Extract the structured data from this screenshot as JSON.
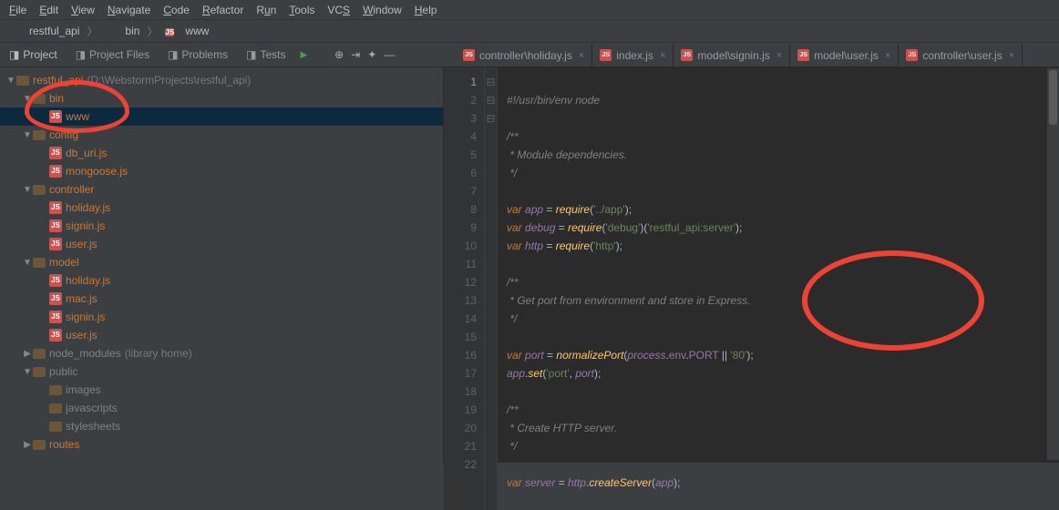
{
  "menu": [
    "File",
    "Edit",
    "View",
    "Navigate",
    "Code",
    "Refactor",
    "Run",
    "Tools",
    "VCS",
    "Window",
    "Help"
  ],
  "breadcrumb": [
    {
      "icon": "folder",
      "label": "restful_api"
    },
    {
      "icon": "folder",
      "label": "bin"
    },
    {
      "icon": "js",
      "label": "www"
    }
  ],
  "toolTabs": [
    {
      "icon": "project",
      "label": "Project",
      "selected": true
    },
    {
      "icon": "files",
      "label": "Project Files"
    },
    {
      "icon": "problem",
      "label": "Problems"
    },
    {
      "icon": "test",
      "label": "Tests"
    }
  ],
  "tree": [
    {
      "d": 0,
      "tw": "▼",
      "ico": "prj",
      "lbl": "restful_api",
      "hint": "(D:\\WebstormProjects\\restful_api)"
    },
    {
      "d": 1,
      "tw": "▼",
      "ico": "folder",
      "lbl": "bin"
    },
    {
      "d": 2,
      "tw": "",
      "ico": "js",
      "lbl": "www",
      "sel": true
    },
    {
      "d": 1,
      "tw": "▼",
      "ico": "folder",
      "lbl": "config"
    },
    {
      "d": 2,
      "tw": "",
      "ico": "js",
      "lbl": "db_uri.js"
    },
    {
      "d": 2,
      "tw": "",
      "ico": "js",
      "lbl": "mongoose.js"
    },
    {
      "d": 1,
      "tw": "▼",
      "ico": "folder",
      "lbl": "controller"
    },
    {
      "d": 2,
      "tw": "",
      "ico": "js",
      "lbl": "holiday.js"
    },
    {
      "d": 2,
      "tw": "",
      "ico": "js",
      "lbl": "signin.js"
    },
    {
      "d": 2,
      "tw": "",
      "ico": "js",
      "lbl": "user.js"
    },
    {
      "d": 1,
      "tw": "▼",
      "ico": "folder",
      "lbl": "model"
    },
    {
      "d": 2,
      "tw": "",
      "ico": "js",
      "lbl": "holiday.js"
    },
    {
      "d": 2,
      "tw": "",
      "ico": "js",
      "lbl": "mac.js"
    },
    {
      "d": 2,
      "tw": "",
      "ico": "js",
      "lbl": "signin.js"
    },
    {
      "d": 2,
      "tw": "",
      "ico": "js",
      "lbl": "user.js"
    },
    {
      "d": 1,
      "tw": "▶",
      "ico": "folder",
      "lbl": "node_modules",
      "hint": "(library home)",
      "dim": true
    },
    {
      "d": 1,
      "tw": "▼",
      "ico": "folder",
      "lbl": "public",
      "dim": true
    },
    {
      "d": 2,
      "tw": "",
      "ico": "folder",
      "lbl": "images",
      "dim": true
    },
    {
      "d": 2,
      "tw": "",
      "ico": "folder",
      "lbl": "javascripts",
      "dim": true
    },
    {
      "d": 2,
      "tw": "",
      "ico": "folder",
      "lbl": "stylesheets",
      "dim": true
    },
    {
      "d": 1,
      "tw": "▶",
      "ico": "folder",
      "lbl": "routes"
    }
  ],
  "editorTabs": [
    {
      "label": "controller\\holiday.js"
    },
    {
      "label": "index.js"
    },
    {
      "label": "model\\signin.js"
    },
    {
      "label": "model\\user.js"
    },
    {
      "label": "controller\\user.js"
    }
  ],
  "code": {
    "l1": "#!/usr/bin/env node",
    "l4": " * Module dependencies.",
    "l7a": "var",
    "l7b": "app",
    "l7c": "require",
    "l7d": "'../app'",
    "l8a": "var",
    "l8b": "debug",
    "l8c": "require",
    "l8d": "'debug'",
    "l8e": "'restful_api:server'",
    "l9a": "var",
    "l9b": "http",
    "l9c": "require",
    "l9d": "'http'",
    "l12": " * Get port from environment and store in Express.",
    "l15a": "var",
    "l15b": "port",
    "l15c": "normalizePort",
    "l15d": "process",
    "l15e": "env",
    "l15f": "PORT",
    "l15g": "'80'",
    "l16a": "app",
    "l16b": "set",
    "l16c": "'port'",
    "l16d": "port",
    "l19": " * Create HTTP server.",
    "l22a": "var",
    "l22b": "server",
    "l22c": "http",
    "l22d": "createServer",
    "l22e": "app"
  }
}
